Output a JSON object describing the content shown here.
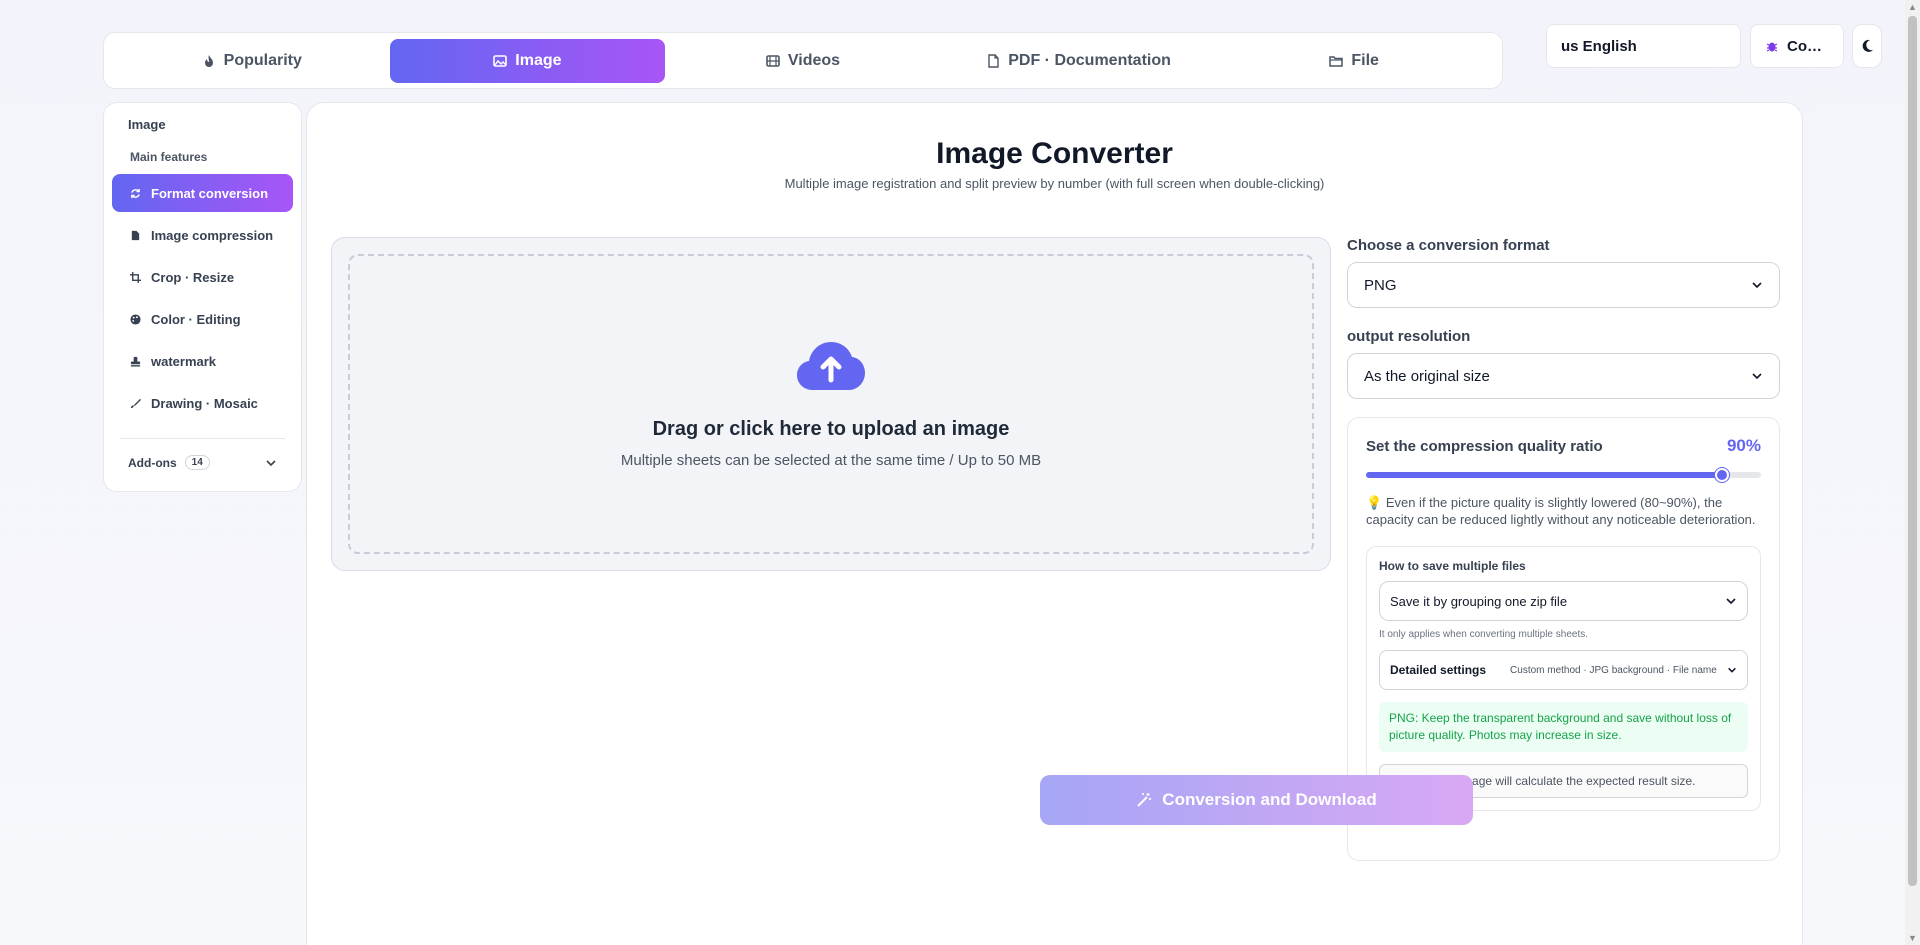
{
  "nav": {
    "tabs": [
      {
        "label": "Popularity",
        "icon": "flame-icon"
      },
      {
        "label": "Image",
        "icon": "image-icon",
        "active": true
      },
      {
        "label": "Videos",
        "icon": "film-icon"
      },
      {
        "label": "PDF · Documentation",
        "icon": "pdf-icon"
      },
      {
        "label": "File",
        "icon": "folder-icon"
      }
    ],
    "language": "us English",
    "company_label": "Co…"
  },
  "sidebar": {
    "title": "Image",
    "section": "Main features",
    "items": [
      {
        "label": "Format conversion",
        "icon": "refresh-icon",
        "active": true
      },
      {
        "label": "Image compression",
        "icon": "file-icon"
      },
      {
        "label": "Crop · Resize",
        "icon": "crop-icon"
      },
      {
        "label": "Color · Editing",
        "icon": "palette-icon"
      },
      {
        "label": "watermark",
        "icon": "stamp-icon"
      },
      {
        "label": "Drawing · Mosaic",
        "icon": "brush-icon"
      }
    ],
    "addons_label": "Add-ons",
    "addons_count": "14"
  },
  "main": {
    "title": "Image Converter",
    "subtitle": "Multiple image registration and split preview by number (with full screen when double-clicking)",
    "upload_title": "Drag or click here to upload an image",
    "upload_sub": "Multiple sheets can be selected at the same time / Up to 50 MB"
  },
  "panel": {
    "format_label": "Choose a conversion format",
    "format_value": "PNG",
    "resolution_label": "output resolution",
    "resolution_value": "As the original size",
    "quality_label": "Set the compression quality ratio",
    "quality_value": "90%",
    "quality_level": 0.9,
    "quality_tip": "Even if the picture quality is slightly lowered (80~90%), the capacity can be reduced lightly without any noticeable deterioration.",
    "multi_label": "How to save multiple files",
    "multi_value": "Save it by grouping one zip file",
    "multi_note": "It only applies when converting multiple sheets.",
    "detail_title": "Detailed settings",
    "detail_desc": "Custom method · JPG background · File name",
    "png_note": "PNG: Keep the transparent background and save without loss of picture quality. Photos may increase in size.",
    "calc_note": "Selecting an image will calculate the expected result size.",
    "convert_label": "Conversion and Download"
  },
  "colors": {
    "accent": "#6366f1",
    "accent2": "#a855f7",
    "success": "#16a34a"
  }
}
